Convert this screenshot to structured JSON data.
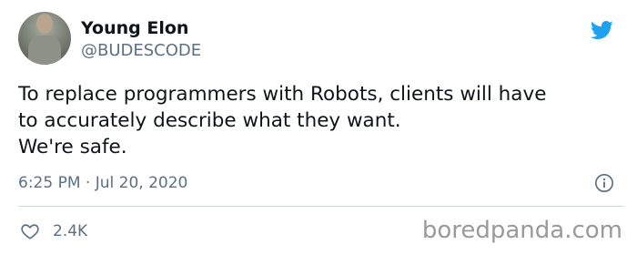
{
  "tweet": {
    "author_name": "Young Elon",
    "author_handle": "@BUDESCODE",
    "text_lines": [
      "To replace programmers with Robots, clients will have",
      "to accurately describe what they want.",
      "We're safe."
    ],
    "timestamp": "6:25 PM · Jul 20, 2020",
    "like_count": "2.4K"
  },
  "watermark": "boredpanda.com",
  "icons": {
    "brand": "twitter-bird-icon",
    "info": "info-icon",
    "like": "heart-icon"
  },
  "colors": {
    "twitter_blue": "#1da1f2",
    "secondary_text": "#5b7083",
    "primary_text": "#0f1419",
    "watermark": "#9a9a9a"
  }
}
